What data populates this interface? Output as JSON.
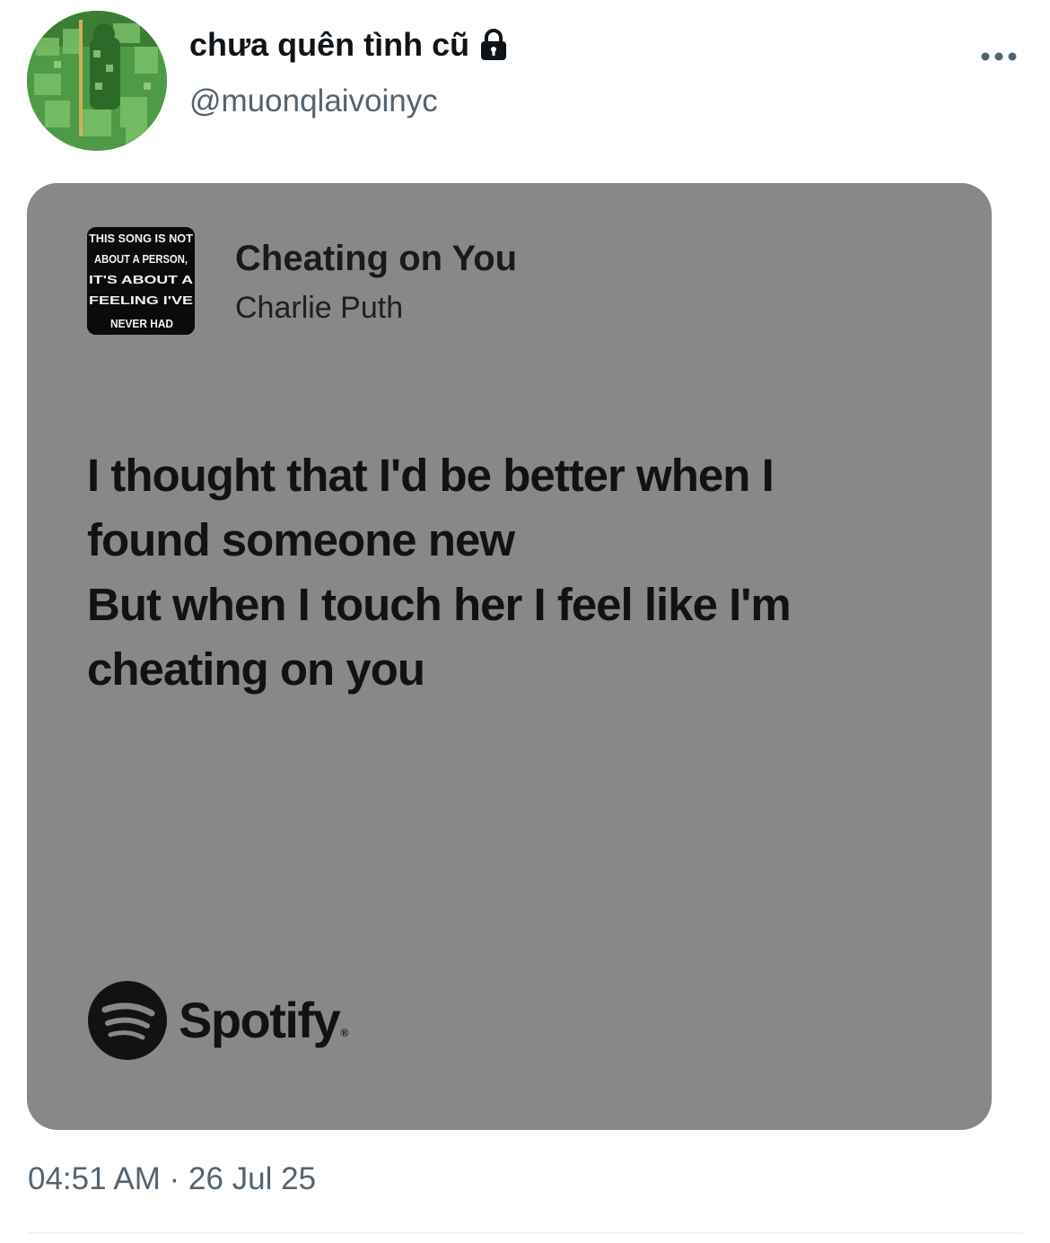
{
  "user": {
    "display_name": "chưa quên tình cũ",
    "handle": "@muonqlaivoinyc",
    "avatar_icon": "avatar-photo",
    "protected_icon": "lock-icon"
  },
  "actions": {
    "more_icon": "more-horizontal-icon"
  },
  "card": {
    "background": "#888888",
    "album_art_text": [
      "THIS SONG IS NOT",
      "ABOUT A PERSON,",
      "IT'S ABOUT A",
      "FEELING I'VE",
      "NEVER HAD"
    ],
    "song_title": "Cheating on You",
    "artist": "Charlie Puth",
    "lyrics": [
      "I thought that I'd be better when I",
      "found someone new",
      "But when I touch her I feel like I'm",
      "cheating on you"
    ],
    "brand": "Spotify",
    "brand_icon": "spotify-icon"
  },
  "timestamp": "04:51 AM · 26 Jul 25"
}
